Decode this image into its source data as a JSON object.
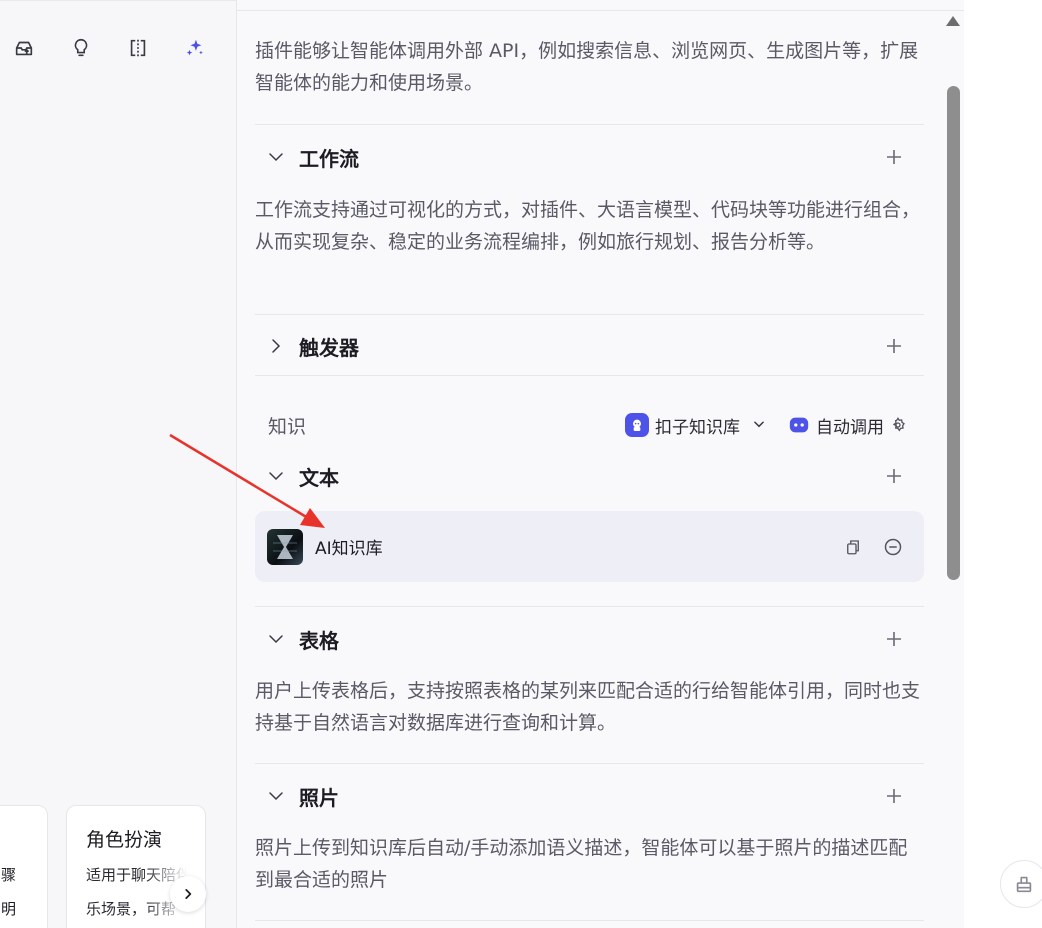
{
  "left_panel": {
    "toolbar_icons": [
      "inbox-upload-icon",
      "lightbulb-icon",
      "split-view-icon",
      "sparkle-icon"
    ],
    "partial_card": {
      "line1": "骤",
      "line2": "明"
    },
    "role_card": {
      "title": "角色扮演",
      "line1": "适用于聊天陪伴",
      "line2": "乐场景，可帮"
    }
  },
  "plugins": {
    "description": "插件能够让智能体调用外部 API，例如搜索信息、浏览网页、生成图片等，扩展智能体的能力和使用场景。"
  },
  "workflow": {
    "title": "工作流",
    "description": "工作流支持通过可视化的方式，对插件、大语言模型、代码块等功能进行组合，从而实现复杂、稳定的业务流程编排，例如旅行规划、报告分析等。"
  },
  "trigger": {
    "title": "触发器"
  },
  "knowledge": {
    "label": "知识",
    "kb_select": "扣子知识库",
    "auto_call": "自动调用"
  },
  "text": {
    "title": "文本",
    "item_name": "AI知识库"
  },
  "table": {
    "title": "表格",
    "description": "用户上传表格后，支持按照表格的某列来匹配合适的行给智能体引用，同时也支持基于自然语言对数据库进行查询和计算。"
  },
  "photo": {
    "title": "照片",
    "description": "照片上传到知识库后自动/手动添加语义描述，智能体可以基于照片的描述匹配到最合适的照片"
  },
  "colors": {
    "accent": "#4d53e8",
    "annotation_arrow": "#e8332a"
  }
}
